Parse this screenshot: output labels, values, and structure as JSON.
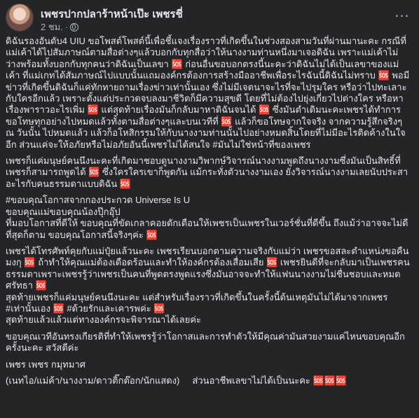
{
  "post": {
    "author_name": "เพชรปากปลาร้าหน้าเป๊ะ เพชรชี่",
    "time": "2 ชม.",
    "paragraphs": [
      "ดิฉันรองอันดับ4 UIU ขอโพสต์โพสต์นี้เพื่อชี้แจงเรื่องราวที่เกิดขึ้นในช่วงสองสามวันที่ผ่านมานะคะ กรณีที่แม่เค้าได้ไปสัมภาษณ์ตามสื่อต่างๆแล้วบอกกับทุกสื่อว่าให้นางงามท่านหนึ่งมาเจอดิฉัน เพราะแม่เค้าไม่ว่างพร้อมทั้งบอกกับทุกคนว่าดิฉันเป็นเลขา 🆘 ก่อนอื่นขอบอกตรงนี้นะคะว่าดิฉันไม่ได้เป็นเลขาของแม่เค้า ที่แม่เกทได้สัมภาษณ์ไปแบบนั้นแถมองค์กรต้องการสร้างมืออาชีพเพื่อระไรฉันนี้ดิฉันไม่ทราบ 🆘 พอมีข่าวที่เกิดขึ้นดิฉันก็แค่ทักทายถามเรื่องข่าวเท่านั้นเอง ซึ่งไม่มีเจตนาจะไรที่จะไปรุมใคร หรือว่าไปทะเลาะกับใครอีกแล้ว เพราะตั้งแต่ประกวดจบลงมาชีวิตก็มีความสุขดี โดยที่ไม่ต้องไปยุ่งเกี่ยวไปต่างใคร หรือหาเรื่องพาราวอะไรเพิ่ม 🆘 แต่สุดท้ายเรื่องมันก็กลับมาหาดิฉันจนได้ 🆘 ซึ่งมันตำเดิมนะคะเพชรได้ทำการขอโทษทุกอย่างไปหมดแล้วทั้งตามสื่อต่างๆและบนเวทีที่ 🆘 แล้วก็ขอโทษจากใจจริง จากความรู้สึกจริงๆ ณ วันนั้น ไปหมดแล้ว แล้วก็อโหสิกรรมให้กับนางงามท่านนั้นไปอย่างหมดสิ้นโดยที่ไม่มีอะไรติดค้างในใจอีก ส่วนแค่จะให้อภัยหรือไม่อภัยอันนี้เพชรไม่ได้สนใจ #มันไม่ใช่หน้าที่ของเพชร",
      "เพชรก็แค่มนุษย์คนนึงนะคะที่เกิดมาชอบดูนางงามวิพากษ์วิจารณ์นางงามพูดถึงนางงามซึ่งมันเป็นสิทธิ์ที่เพชรก็สามารถพูดได้ 🆘 ซึ่งใครใครเขาก็พูดกัน แม้กระทั่งตัวนางงามเอง ยังวิจารณ์นางงามเลยนับประสาอะไรกับคนธรรมดาแบบดิฉัน 🆘",
      "#ขอบคุณโอกาสจากกองประกวด Universe Is U\nขอบคุณแม่ขอบคุณน้องปุ๊กอุ๊ป\nที่มอบโอกาสที่ดีให้ ขอบคุณที่ขัดเกลาคอยดักเตือนให้เพชรเป็นเพชรในเวอร์ชั่นที่ดีขึ้น ถึงแม้ว่าอาจจะไม่ดีที่สุดก็ตาม ขอบคุณโอกาสนี้จริงๆค่ะ 🆘",
      "เพชรได้โทรศัพท์คุยกับแม่ปุ๋ยแล้วนะคะ เพชรเรียนบอกตามความจริงกับแม่ว่า เพชรขอสละตำแหน่งขอคืนมงกุ 🆘 ถ้าทำให้คุณแม่ต้องเดือดร้อนและทำให้องค์กรต้องเสื่อมเสีย 🆘 เพชรยินดีที่จะกลับมาเป็นเพชรคนธรรมดาเพราะเพชรรู้ว่าเพชรเป็นคนที่พูดตรงพูดแรงซึ่งมันอาจจะทำให้แฟนนางงามไม่ชื่นชอบและหมดศรัทธา 🆘\nสุดท้ายเพชรก็แค่มนุษย์คนนึงนะคะ แต่สำหรับเรื่องราวที่เกิดขึ้นในครั้งนี้ต้นเหตุมันไม่ได้มาจากเพชร\n#เท่านั้นเอง 🆘 #ด้วยรักและเคารพค่ะ 🆘\nสุดท้ายแล้วแล้วแต่ทางองค์กรจะพิจารณาได้เลยค่ะ",
      "ขอบคุณเวทีอันทรงเกียรติที่ทำให้เพชรรู้ว่าโอกาสและการทำตัวให้มีคุณค่ามันสวยงามแค่ไหนขอบคุณอีกครั้งนะคะ สวัสดีค่ะ",
      "เพชร เพชร กมุทมาศ",
      "(เนทไอ/แม่ค้า/นางงาม/ดาวติ๊กต๊อก/นักแสดง)     ส่วนอาชีพเลขาไม่ได้เป็นนะคะ 🆘🆘🆘"
    ]
  }
}
